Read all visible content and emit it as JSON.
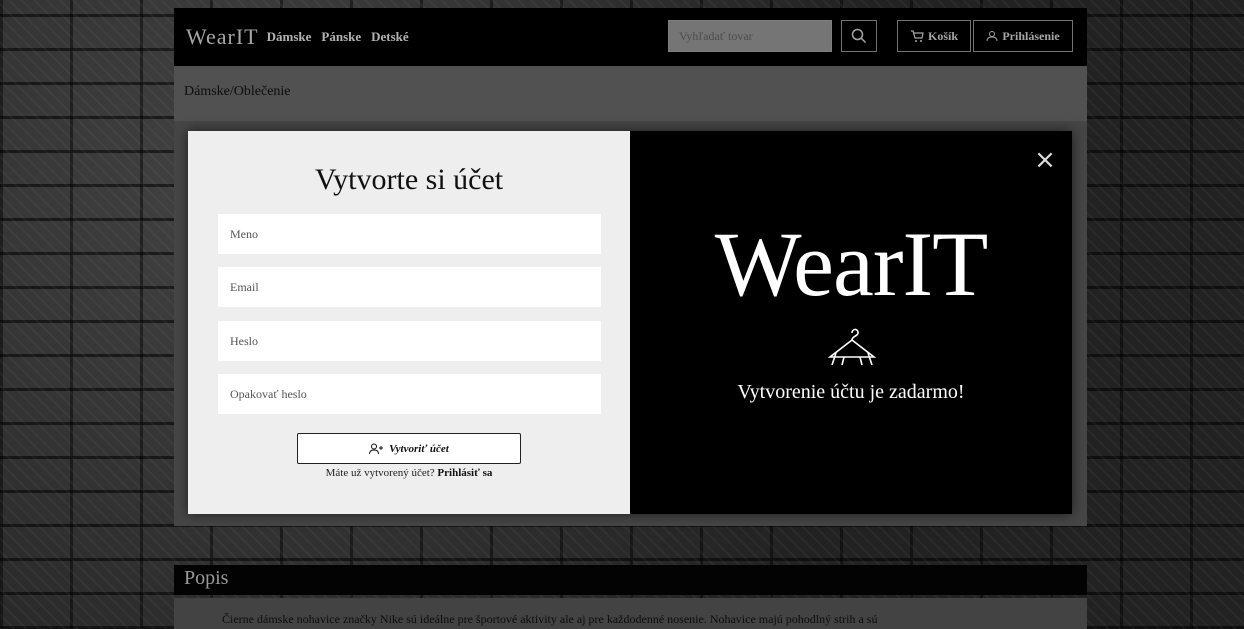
{
  "header": {
    "logo": "WearIT",
    "nav": [
      "Dámske",
      "Pánske",
      "Detské"
    ],
    "search_placeholder": "Vyhľadať tovar",
    "cart_label": "Košík",
    "login_label": "Prihlásenie"
  },
  "breadcrumb": "Dámske/Oblečenie",
  "section": {
    "title": "Popis",
    "text": "Čierne dámske nohavice značky Nike sú ideálne pre športové aktivity ale aj pre každodenné nosenie. Nohavice majú pohodlný strih a sú"
  },
  "modal": {
    "title": "Vytvorte si účet",
    "fields": [
      {
        "placeholder": "Meno"
      },
      {
        "placeholder": "Email"
      },
      {
        "placeholder": "Heslo"
      },
      {
        "placeholder": "Opakovať heslo"
      }
    ],
    "submit_label": "Vytvoriť účet",
    "already_text": "Máte už vytvorený účet?",
    "login_link": "Prihlásiť sa",
    "brand": "WearIT",
    "tagline": "Vytvorenie účtu je zadarmo!",
    "close_symbol": "×"
  },
  "icons": {
    "search": "search-icon",
    "cart": "cart-icon",
    "user": "user-icon",
    "add_user": "add-user-icon",
    "close": "close-icon",
    "hanger": "hanger-icon"
  }
}
